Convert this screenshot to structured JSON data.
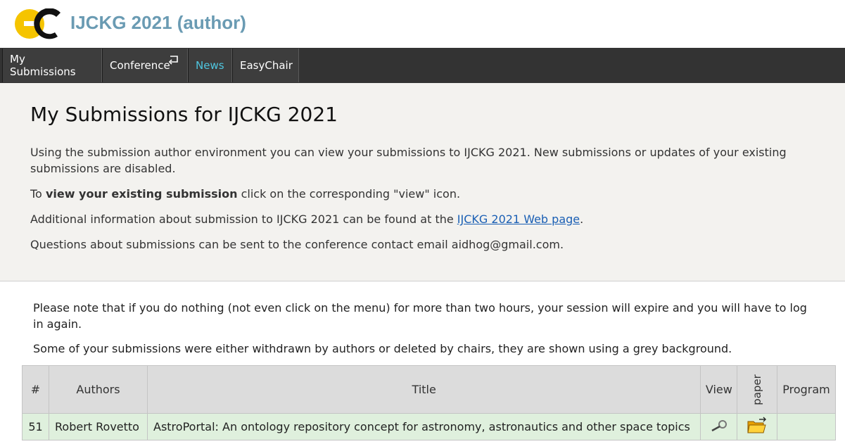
{
  "header": {
    "title": "IJCKG 2021 (author)",
    "title_color": "#6a9bb3"
  },
  "menu": [
    {
      "label": "My Submissions"
    },
    {
      "label": "Conference"
    },
    {
      "label": "News"
    },
    {
      "label": "EasyChair"
    }
  ],
  "intro": {
    "title": "My Submissions for IJCKG 2021",
    "p1": "Using the submission author environment you can view your submissions to IJCKG 2021. New submissions or updates of your existing submissions are disabled.",
    "p2_prefix": "To ",
    "p2_bold": "view your existing submission",
    "p2_suffix": " click on the corresponding \"view\" icon.",
    "p3_prefix": "Additional information about submission to IJCKG 2021 can be found at the ",
    "p3_link": "IJCKG 2021 Web page",
    "p3_suffix": ".",
    "p4": "Questions about submissions can be sent to the conference contact email aidhog@gmail.com."
  },
  "notes": {
    "n1": "Please note that if you do nothing (not even click on the menu) for more than two hours, your session will expire and you will have to log in again.",
    "n2": "Some of your submissions were either withdrawn by authors or deleted by chairs, they are shown using a grey background."
  },
  "table": {
    "headers": {
      "num": "#",
      "authors": "Authors",
      "title": "Title",
      "view": "View",
      "paper": "paper",
      "program": "Program"
    },
    "rows": [
      {
        "num": "51",
        "authors": "Robert Rovetto",
        "title": "AstroPortal: An ontology repository concept for astronomy, astronautics and other space topics",
        "program": ""
      }
    ]
  },
  "icons": {
    "logo": "easychair-logo",
    "view": "magnifier-icon",
    "paper": "folder-icon"
  }
}
